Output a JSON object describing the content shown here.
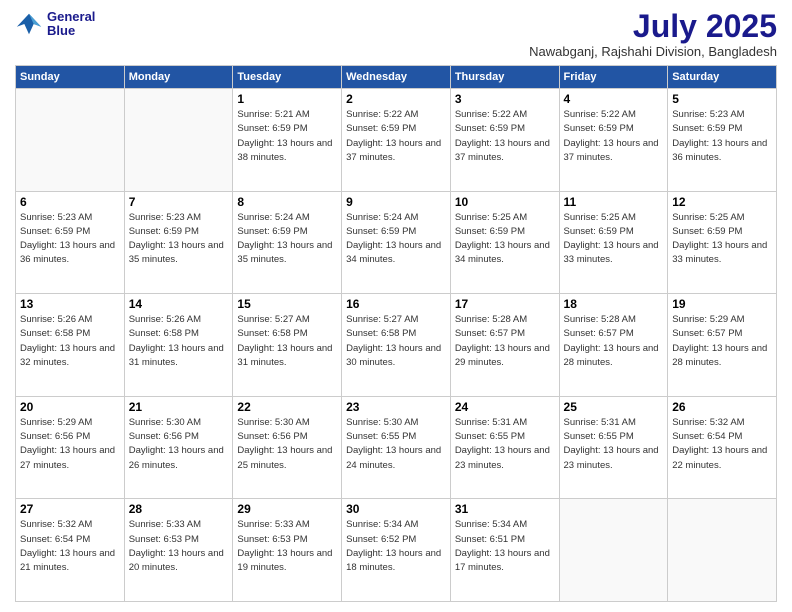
{
  "header": {
    "logo_line1": "General",
    "logo_line2": "Blue",
    "title": "July 2025",
    "location": "Nawabganj, Rajshahi Division, Bangladesh"
  },
  "days_of_week": [
    "Sunday",
    "Monday",
    "Tuesday",
    "Wednesday",
    "Thursday",
    "Friday",
    "Saturday"
  ],
  "weeks": [
    [
      {
        "day": "",
        "sunrise": "",
        "sunset": "",
        "daylight": ""
      },
      {
        "day": "",
        "sunrise": "",
        "sunset": "",
        "daylight": ""
      },
      {
        "day": "1",
        "sunrise": "Sunrise: 5:21 AM",
        "sunset": "Sunset: 6:59 PM",
        "daylight": "Daylight: 13 hours and 38 minutes."
      },
      {
        "day": "2",
        "sunrise": "Sunrise: 5:22 AM",
        "sunset": "Sunset: 6:59 PM",
        "daylight": "Daylight: 13 hours and 37 minutes."
      },
      {
        "day": "3",
        "sunrise": "Sunrise: 5:22 AM",
        "sunset": "Sunset: 6:59 PM",
        "daylight": "Daylight: 13 hours and 37 minutes."
      },
      {
        "day": "4",
        "sunrise": "Sunrise: 5:22 AM",
        "sunset": "Sunset: 6:59 PM",
        "daylight": "Daylight: 13 hours and 37 minutes."
      },
      {
        "day": "5",
        "sunrise": "Sunrise: 5:23 AM",
        "sunset": "Sunset: 6:59 PM",
        "daylight": "Daylight: 13 hours and 36 minutes."
      }
    ],
    [
      {
        "day": "6",
        "sunrise": "Sunrise: 5:23 AM",
        "sunset": "Sunset: 6:59 PM",
        "daylight": "Daylight: 13 hours and 36 minutes."
      },
      {
        "day": "7",
        "sunrise": "Sunrise: 5:23 AM",
        "sunset": "Sunset: 6:59 PM",
        "daylight": "Daylight: 13 hours and 35 minutes."
      },
      {
        "day": "8",
        "sunrise": "Sunrise: 5:24 AM",
        "sunset": "Sunset: 6:59 PM",
        "daylight": "Daylight: 13 hours and 35 minutes."
      },
      {
        "day": "9",
        "sunrise": "Sunrise: 5:24 AM",
        "sunset": "Sunset: 6:59 PM",
        "daylight": "Daylight: 13 hours and 34 minutes."
      },
      {
        "day": "10",
        "sunrise": "Sunrise: 5:25 AM",
        "sunset": "Sunset: 6:59 PM",
        "daylight": "Daylight: 13 hours and 34 minutes."
      },
      {
        "day": "11",
        "sunrise": "Sunrise: 5:25 AM",
        "sunset": "Sunset: 6:59 PM",
        "daylight": "Daylight: 13 hours and 33 minutes."
      },
      {
        "day": "12",
        "sunrise": "Sunrise: 5:25 AM",
        "sunset": "Sunset: 6:59 PM",
        "daylight": "Daylight: 13 hours and 33 minutes."
      }
    ],
    [
      {
        "day": "13",
        "sunrise": "Sunrise: 5:26 AM",
        "sunset": "Sunset: 6:58 PM",
        "daylight": "Daylight: 13 hours and 32 minutes."
      },
      {
        "day": "14",
        "sunrise": "Sunrise: 5:26 AM",
        "sunset": "Sunset: 6:58 PM",
        "daylight": "Daylight: 13 hours and 31 minutes."
      },
      {
        "day": "15",
        "sunrise": "Sunrise: 5:27 AM",
        "sunset": "Sunset: 6:58 PM",
        "daylight": "Daylight: 13 hours and 31 minutes."
      },
      {
        "day": "16",
        "sunrise": "Sunrise: 5:27 AM",
        "sunset": "Sunset: 6:58 PM",
        "daylight": "Daylight: 13 hours and 30 minutes."
      },
      {
        "day": "17",
        "sunrise": "Sunrise: 5:28 AM",
        "sunset": "Sunset: 6:57 PM",
        "daylight": "Daylight: 13 hours and 29 minutes."
      },
      {
        "day": "18",
        "sunrise": "Sunrise: 5:28 AM",
        "sunset": "Sunset: 6:57 PM",
        "daylight": "Daylight: 13 hours and 28 minutes."
      },
      {
        "day": "19",
        "sunrise": "Sunrise: 5:29 AM",
        "sunset": "Sunset: 6:57 PM",
        "daylight": "Daylight: 13 hours and 28 minutes."
      }
    ],
    [
      {
        "day": "20",
        "sunrise": "Sunrise: 5:29 AM",
        "sunset": "Sunset: 6:56 PM",
        "daylight": "Daylight: 13 hours and 27 minutes."
      },
      {
        "day": "21",
        "sunrise": "Sunrise: 5:30 AM",
        "sunset": "Sunset: 6:56 PM",
        "daylight": "Daylight: 13 hours and 26 minutes."
      },
      {
        "day": "22",
        "sunrise": "Sunrise: 5:30 AM",
        "sunset": "Sunset: 6:56 PM",
        "daylight": "Daylight: 13 hours and 25 minutes."
      },
      {
        "day": "23",
        "sunrise": "Sunrise: 5:30 AM",
        "sunset": "Sunset: 6:55 PM",
        "daylight": "Daylight: 13 hours and 24 minutes."
      },
      {
        "day": "24",
        "sunrise": "Sunrise: 5:31 AM",
        "sunset": "Sunset: 6:55 PM",
        "daylight": "Daylight: 13 hours and 23 minutes."
      },
      {
        "day": "25",
        "sunrise": "Sunrise: 5:31 AM",
        "sunset": "Sunset: 6:55 PM",
        "daylight": "Daylight: 13 hours and 23 minutes."
      },
      {
        "day": "26",
        "sunrise": "Sunrise: 5:32 AM",
        "sunset": "Sunset: 6:54 PM",
        "daylight": "Daylight: 13 hours and 22 minutes."
      }
    ],
    [
      {
        "day": "27",
        "sunrise": "Sunrise: 5:32 AM",
        "sunset": "Sunset: 6:54 PM",
        "daylight": "Daylight: 13 hours and 21 minutes."
      },
      {
        "day": "28",
        "sunrise": "Sunrise: 5:33 AM",
        "sunset": "Sunset: 6:53 PM",
        "daylight": "Daylight: 13 hours and 20 minutes."
      },
      {
        "day": "29",
        "sunrise": "Sunrise: 5:33 AM",
        "sunset": "Sunset: 6:53 PM",
        "daylight": "Daylight: 13 hours and 19 minutes."
      },
      {
        "day": "30",
        "sunrise": "Sunrise: 5:34 AM",
        "sunset": "Sunset: 6:52 PM",
        "daylight": "Daylight: 13 hours and 18 minutes."
      },
      {
        "day": "31",
        "sunrise": "Sunrise: 5:34 AM",
        "sunset": "Sunset: 6:51 PM",
        "daylight": "Daylight: 13 hours and 17 minutes."
      },
      {
        "day": "",
        "sunrise": "",
        "sunset": "",
        "daylight": ""
      },
      {
        "day": "",
        "sunrise": "",
        "sunset": "",
        "daylight": ""
      }
    ]
  ]
}
